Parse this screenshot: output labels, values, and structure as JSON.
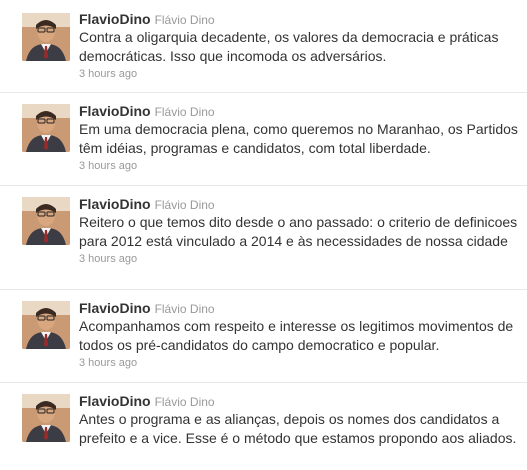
{
  "tweets": [
    {
      "screen_name": "FlavioDino",
      "full_name": "Flávio Dino",
      "text": "Contra a oligarquia decadente, os valores da democracia e práticas democráticas. Isso que incomoda os adversários.",
      "time": "3 hours ago"
    },
    {
      "screen_name": "FlavioDino",
      "full_name": "Flávio Dino",
      "text": "Em uma democracia plena, como queremos no Maranhao, os Partidos têm idéias, programas e candidatos, com total liberdade.",
      "time": "3 hours ago"
    },
    {
      "screen_name": "FlavioDino",
      "full_name": "Flávio Dino",
      "text": "Reitero o que temos dito desde o ano passado: o criterio de definicoes para 2012 está vinculado a 2014 e às necessidades de nossa cidade",
      "time": "3 hours ago"
    },
    {
      "screen_name": "FlavioDino",
      "full_name": "Flávio Dino",
      "text": "Acompanhamos com respeito e interesse os legitimos movimentos de todos os pré-candidatos do campo democratico e popular.",
      "time": "3 hours ago"
    },
    {
      "screen_name": "FlavioDino",
      "full_name": "Flávio Dino",
      "text": "Antes o programa e as alianças, depois os nomes dos candidatos a prefeito e a vice. Esse é o método que estamos propondo aos aliados."
    }
  ],
  "colors": {
    "text": "#333333",
    "muted": "#999999",
    "divider": "#e8e8e8"
  }
}
